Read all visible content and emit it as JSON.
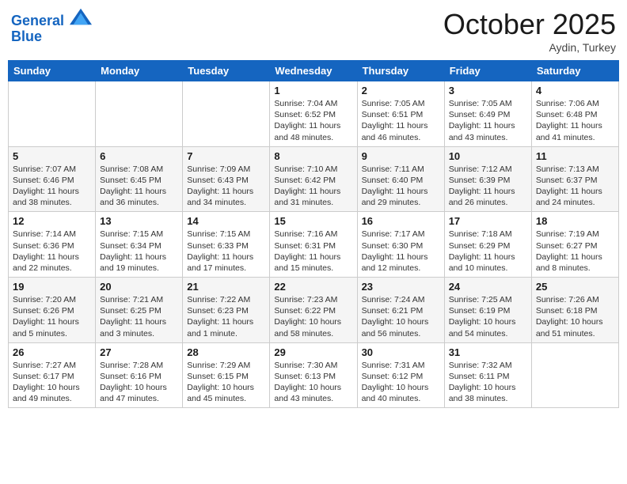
{
  "header": {
    "logo_line1": "General",
    "logo_line2": "Blue",
    "month": "October 2025",
    "location": "Aydin, Turkey"
  },
  "weekdays": [
    "Sunday",
    "Monday",
    "Tuesday",
    "Wednesday",
    "Thursday",
    "Friday",
    "Saturday"
  ],
  "weeks": [
    [
      null,
      null,
      null,
      {
        "day": "1",
        "sunrise": "7:04 AM",
        "sunset": "6:52 PM",
        "daylight": "11 hours and 48 minutes."
      },
      {
        "day": "2",
        "sunrise": "7:05 AM",
        "sunset": "6:51 PM",
        "daylight": "11 hours and 46 minutes."
      },
      {
        "day": "3",
        "sunrise": "7:05 AM",
        "sunset": "6:49 PM",
        "daylight": "11 hours and 43 minutes."
      },
      {
        "day": "4",
        "sunrise": "7:06 AM",
        "sunset": "6:48 PM",
        "daylight": "11 hours and 41 minutes."
      }
    ],
    [
      {
        "day": "5",
        "sunrise": "7:07 AM",
        "sunset": "6:46 PM",
        "daylight": "11 hours and 38 minutes."
      },
      {
        "day": "6",
        "sunrise": "7:08 AM",
        "sunset": "6:45 PM",
        "daylight": "11 hours and 36 minutes."
      },
      {
        "day": "7",
        "sunrise": "7:09 AM",
        "sunset": "6:43 PM",
        "daylight": "11 hours and 34 minutes."
      },
      {
        "day": "8",
        "sunrise": "7:10 AM",
        "sunset": "6:42 PM",
        "daylight": "11 hours and 31 minutes."
      },
      {
        "day": "9",
        "sunrise": "7:11 AM",
        "sunset": "6:40 PM",
        "daylight": "11 hours and 29 minutes."
      },
      {
        "day": "10",
        "sunrise": "7:12 AM",
        "sunset": "6:39 PM",
        "daylight": "11 hours and 26 minutes."
      },
      {
        "day": "11",
        "sunrise": "7:13 AM",
        "sunset": "6:37 PM",
        "daylight": "11 hours and 24 minutes."
      }
    ],
    [
      {
        "day": "12",
        "sunrise": "7:14 AM",
        "sunset": "6:36 PM",
        "daylight": "11 hours and 22 minutes."
      },
      {
        "day": "13",
        "sunrise": "7:15 AM",
        "sunset": "6:34 PM",
        "daylight": "11 hours and 19 minutes."
      },
      {
        "day": "14",
        "sunrise": "7:15 AM",
        "sunset": "6:33 PM",
        "daylight": "11 hours and 17 minutes."
      },
      {
        "day": "15",
        "sunrise": "7:16 AM",
        "sunset": "6:31 PM",
        "daylight": "11 hours and 15 minutes."
      },
      {
        "day": "16",
        "sunrise": "7:17 AM",
        "sunset": "6:30 PM",
        "daylight": "11 hours and 12 minutes."
      },
      {
        "day": "17",
        "sunrise": "7:18 AM",
        "sunset": "6:29 PM",
        "daylight": "11 hours and 10 minutes."
      },
      {
        "day": "18",
        "sunrise": "7:19 AM",
        "sunset": "6:27 PM",
        "daylight": "11 hours and 8 minutes."
      }
    ],
    [
      {
        "day": "19",
        "sunrise": "7:20 AM",
        "sunset": "6:26 PM",
        "daylight": "11 hours and 5 minutes."
      },
      {
        "day": "20",
        "sunrise": "7:21 AM",
        "sunset": "6:25 PM",
        "daylight": "11 hours and 3 minutes."
      },
      {
        "day": "21",
        "sunrise": "7:22 AM",
        "sunset": "6:23 PM",
        "daylight": "11 hours and 1 minute."
      },
      {
        "day": "22",
        "sunrise": "7:23 AM",
        "sunset": "6:22 PM",
        "daylight": "10 hours and 58 minutes."
      },
      {
        "day": "23",
        "sunrise": "7:24 AM",
        "sunset": "6:21 PM",
        "daylight": "10 hours and 56 minutes."
      },
      {
        "day": "24",
        "sunrise": "7:25 AM",
        "sunset": "6:19 PM",
        "daylight": "10 hours and 54 minutes."
      },
      {
        "day": "25",
        "sunrise": "7:26 AM",
        "sunset": "6:18 PM",
        "daylight": "10 hours and 51 minutes."
      }
    ],
    [
      {
        "day": "26",
        "sunrise": "7:27 AM",
        "sunset": "6:17 PM",
        "daylight": "10 hours and 49 minutes."
      },
      {
        "day": "27",
        "sunrise": "7:28 AM",
        "sunset": "6:16 PM",
        "daylight": "10 hours and 47 minutes."
      },
      {
        "day": "28",
        "sunrise": "7:29 AM",
        "sunset": "6:15 PM",
        "daylight": "10 hours and 45 minutes."
      },
      {
        "day": "29",
        "sunrise": "7:30 AM",
        "sunset": "6:13 PM",
        "daylight": "10 hours and 43 minutes."
      },
      {
        "day": "30",
        "sunrise": "7:31 AM",
        "sunset": "6:12 PM",
        "daylight": "10 hours and 40 minutes."
      },
      {
        "day": "31",
        "sunrise": "7:32 AM",
        "sunset": "6:11 PM",
        "daylight": "10 hours and 38 minutes."
      },
      null
    ]
  ]
}
